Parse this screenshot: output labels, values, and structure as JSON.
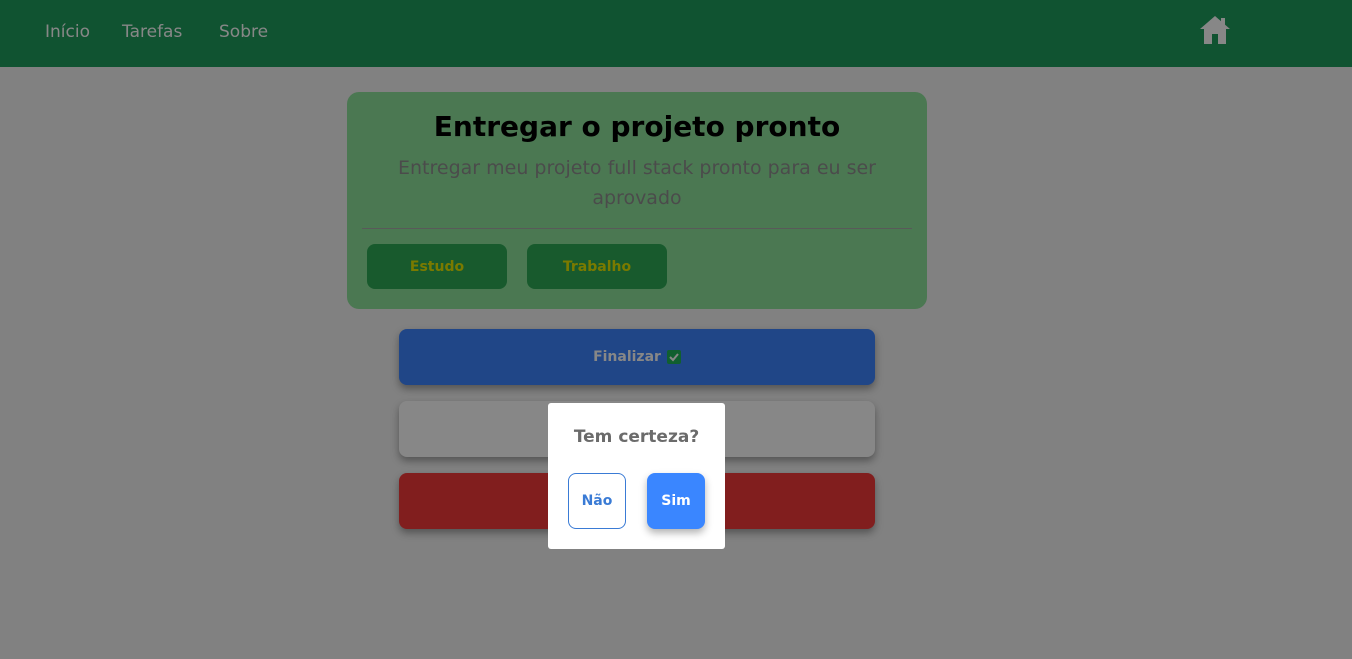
{
  "nav": {
    "links": [
      "Início",
      "Tarefas",
      "Sobre"
    ],
    "home_icon": "home-icon"
  },
  "task": {
    "title": "Entregar o projeto pronto",
    "description": "Entregar meu projeto full stack pronto para eu ser aprovado",
    "tags": [
      "Estudo",
      "Trabalho"
    ]
  },
  "actions": {
    "finalize_label": "Finalizar",
    "finalize_icon": "check-icon",
    "edit_label": "",
    "delete_label": ""
  },
  "modal": {
    "title": "Tem certeza?",
    "no_label": "Não",
    "yes_label": "Sim"
  },
  "colors": {
    "navbar": "#1f9d5e",
    "card": "#8ee39c",
    "tag": "#2eab56",
    "finalize": "#3d84ff",
    "delete": "#f33a3a",
    "confirm": "#3a86ff"
  }
}
